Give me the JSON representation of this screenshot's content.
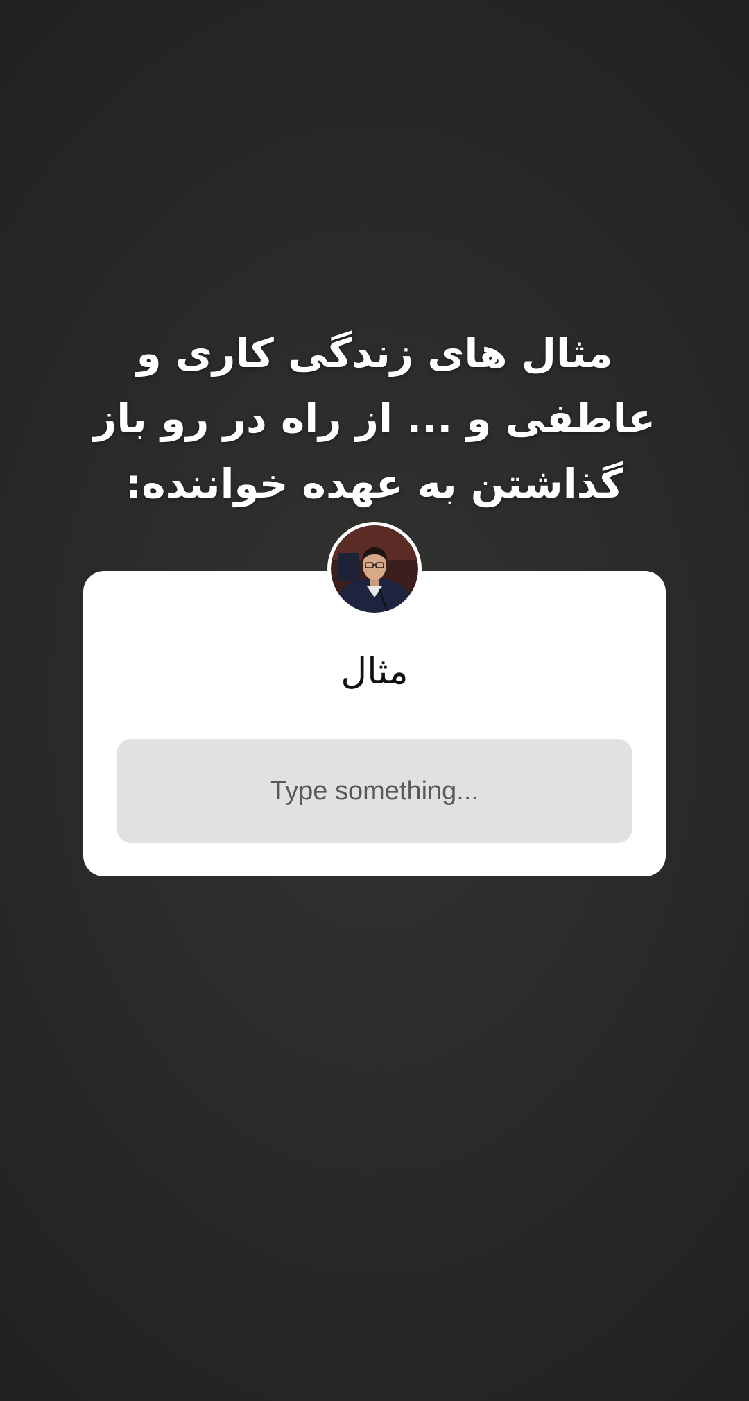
{
  "story": {
    "title": "مثال های زندگی کاری و عاطفی و ... از راه در رو باز گذاشتن به عهده خواننده:"
  },
  "question_sticker": {
    "question": "مثال",
    "answer_placeholder": "Type something..."
  },
  "colors": {
    "card_background": "#ffffff",
    "answer_field_background": "#e1e1e1",
    "title_text": "#ffffff"
  }
}
